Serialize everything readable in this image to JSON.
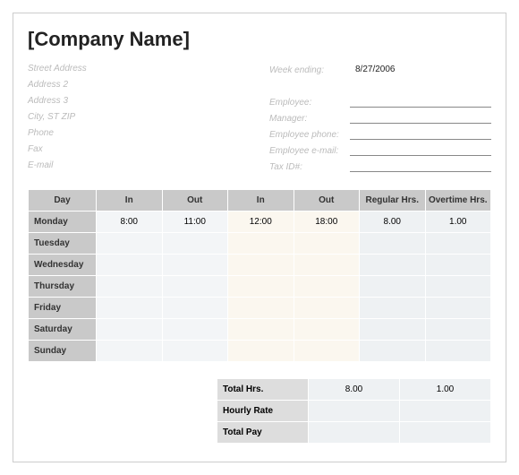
{
  "header": {
    "title": "[Company Name]",
    "left_labels": [
      "Street Address",
      "Address 2",
      "Address 3",
      "City, ST  ZIP",
      "Phone",
      "Fax",
      "E-mail"
    ],
    "right_fields": [
      {
        "label": "Week ending:",
        "value": "8/27/2006",
        "border": false
      },
      {
        "label": "",
        "value": "",
        "border": false
      },
      {
        "label": "Employee:",
        "value": "",
        "border": true
      },
      {
        "label": "Manager:",
        "value": "",
        "border": true
      },
      {
        "label": "Employee phone:",
        "value": "",
        "border": true
      },
      {
        "label": "Employee e-mail:",
        "value": "",
        "border": true
      },
      {
        "label": "Tax ID#:",
        "value": "",
        "border": true
      }
    ]
  },
  "table": {
    "headers": [
      "Day",
      "In",
      "Out",
      "In",
      "Out",
      "Regular Hrs.",
      "Overtime Hrs."
    ],
    "rows": [
      {
        "day": "Monday",
        "in1": "8:00",
        "out1": "11:00",
        "in2": "12:00",
        "out2": "18:00",
        "reg": "8.00",
        "ot": "1.00"
      },
      {
        "day": "Tuesday",
        "in1": "",
        "out1": "",
        "in2": "",
        "out2": "",
        "reg": "",
        "ot": ""
      },
      {
        "day": "Wednesday",
        "in1": "",
        "out1": "",
        "in2": "",
        "out2": "",
        "reg": "",
        "ot": ""
      },
      {
        "day": "Thursday",
        "in1": "",
        "out1": "",
        "in2": "",
        "out2": "",
        "reg": "",
        "ot": ""
      },
      {
        "day": "Friday",
        "in1": "",
        "out1": "",
        "in2": "",
        "out2": "",
        "reg": "",
        "ot": ""
      },
      {
        "day": "Saturday",
        "in1": "",
        "out1": "",
        "in2": "",
        "out2": "",
        "reg": "",
        "ot": ""
      },
      {
        "day": "Sunday",
        "in1": "",
        "out1": "",
        "in2": "",
        "out2": "",
        "reg": "",
        "ot": ""
      }
    ]
  },
  "totals": {
    "rows": [
      {
        "label": "Total Hrs.",
        "reg": "8.00",
        "ot": "1.00"
      },
      {
        "label": "Hourly Rate",
        "reg": "",
        "ot": ""
      },
      {
        "label": "Total Pay",
        "reg": "",
        "ot": ""
      }
    ]
  }
}
